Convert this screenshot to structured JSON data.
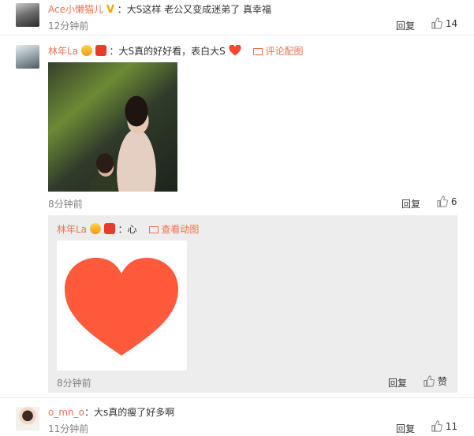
{
  "comments": [
    {
      "username": "Ace小懒猫儿",
      "text": "：大S这样 老公又变成迷弟了 真幸福",
      "time": "12分钟前",
      "reply_label": "回复",
      "like_count": "14"
    },
    {
      "username": "林年La",
      "text": "：大S真的好好看，表白大S",
      "image_link": "评论配图",
      "time": "8分钟前",
      "reply_label": "回复",
      "like_count": "6",
      "sub_comment": {
        "username": "林年La",
        "text": "：心",
        "image_link": "查看动图",
        "time": "8分钟前",
        "reply_label": "回复",
        "like_label": "赞"
      }
    },
    {
      "username": "o_mn_o",
      "text": "：大s真的瘦了好多啊",
      "time": "11分钟前",
      "reply_label": "回复",
      "like_count": "11"
    }
  ],
  "colors": {
    "username": "#eb7350",
    "heart": "#ff5a3c",
    "sub_bg": "#ededed"
  },
  "icons": {
    "like": "thumbs-up-icon",
    "image": "image-icon",
    "heart_emoji": "heart-icon"
  }
}
